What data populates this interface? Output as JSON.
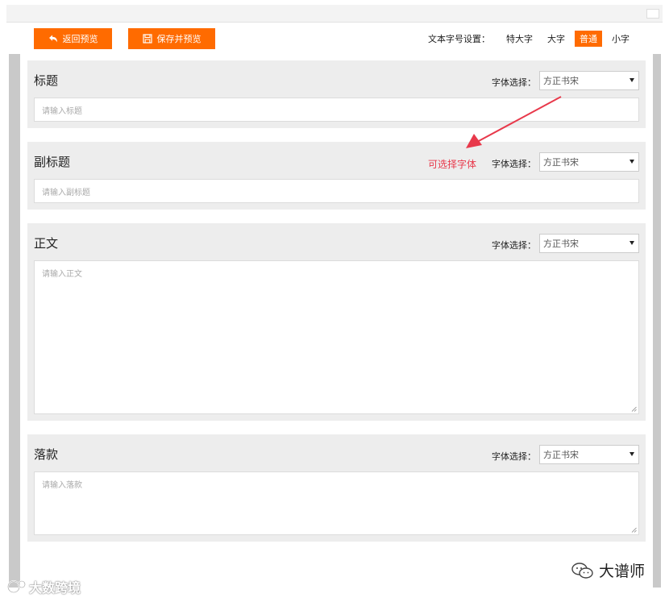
{
  "toolbar": {
    "back_label": "返回预览",
    "save_label": "保存并预览",
    "size_label": "文本字号设置：",
    "size_options": [
      {
        "label": "特大字",
        "active": false
      },
      {
        "label": "大字",
        "active": false
      },
      {
        "label": "普通",
        "active": true
      },
      {
        "label": "小字",
        "active": false
      }
    ]
  },
  "font_label": "字体选择：",
  "sections": [
    {
      "title": "标题",
      "font": "方正书宋",
      "placeholder": "请输入标题"
    },
    {
      "title": "副标题",
      "font": "方正书宋",
      "placeholder": "请输入副标题"
    },
    {
      "title": "正文",
      "font": "方正书宋",
      "placeholder": "请输入正文"
    },
    {
      "title": "落款",
      "font": "方正书宋",
      "placeholder": "请输入落款"
    }
  ],
  "annotation": "可选择字体",
  "watermark_right": "大谱师",
  "watermark_left": "大数跨境",
  "accent_color": "#ff6b00",
  "annotation_color": "#e8394b"
}
